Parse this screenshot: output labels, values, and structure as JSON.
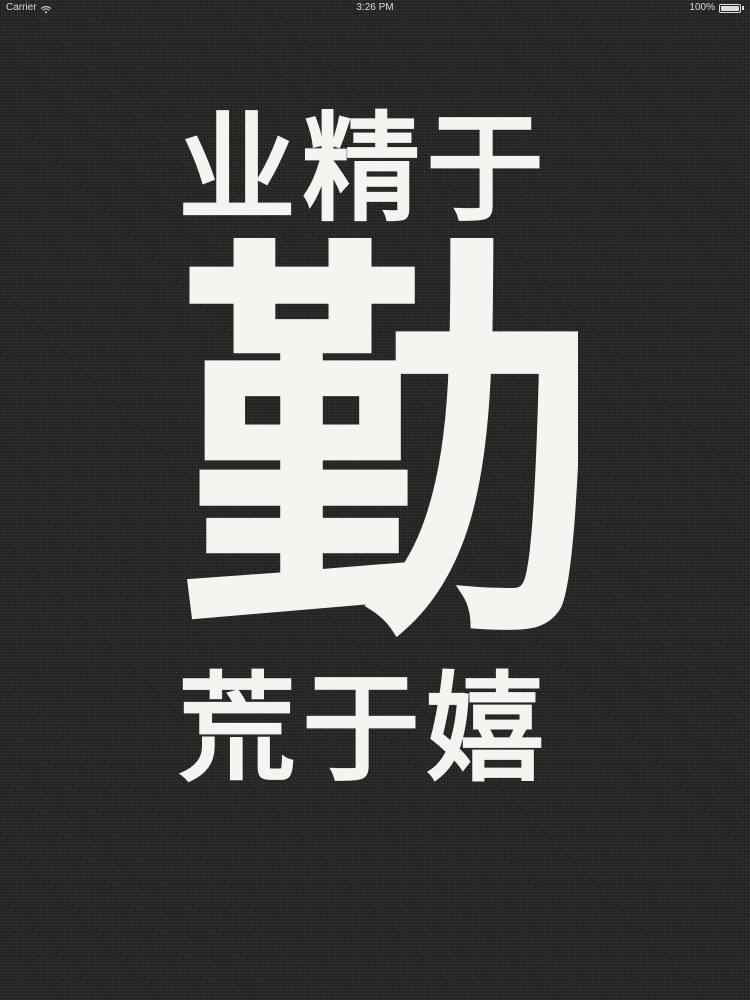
{
  "status_bar": {
    "carrier": "Carrier",
    "time": "3:26 PM",
    "battery": "100%",
    "battery_level": 1.0,
    "icons": [
      "wifi-icon",
      "battery-icon"
    ]
  },
  "poster": {
    "line1": "业精于",
    "big_char": "勤",
    "line3": "荒于嬉",
    "background_color": "#262626",
    "text_color": "#f4f4f0"
  }
}
